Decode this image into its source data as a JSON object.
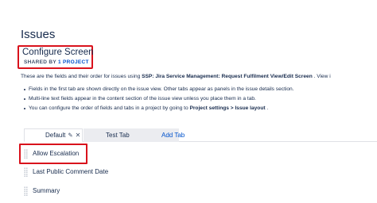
{
  "page": {
    "title": "Issues"
  },
  "screen": {
    "name": "Configure Screen",
    "shared_by_prefix": "SHARED BY",
    "shared_by_link": "1 PROJECT"
  },
  "description": {
    "prefix": "These are the fields and their order for issues using ",
    "screen_ref": "SSP: Jira Service Management: Request Fulfilment View/Edit Screen",
    "suffix": " . View i"
  },
  "bullets": [
    {
      "text": "Fields in the first tab are shown directly on the issue view. Other tabs appear as panels in the issue details section."
    },
    {
      "text": "Multi-line text fields appear in the content section of the issue view unless you place them in a tab."
    },
    {
      "prefix": "You can configure the order of fields and tabs in a project by going to ",
      "strong": "Project settings > Issue layout",
      "suffix": " ."
    }
  ],
  "tabs": [
    {
      "label": "Default",
      "active": true
    },
    {
      "label": "Test Tab",
      "active": false
    }
  ],
  "add_tab_label": "Add Tab",
  "fields": [
    {
      "label": "Allow Escalation"
    },
    {
      "label": "Last Public Comment Date"
    },
    {
      "label": "Summary"
    }
  ],
  "icons": {
    "edit": "pencil-icon",
    "remove": "close-icon",
    "drag": "drag-handle-icon"
  },
  "colors": {
    "highlight": "#d9121c",
    "link": "#0052cc",
    "text": "#172b4d"
  }
}
